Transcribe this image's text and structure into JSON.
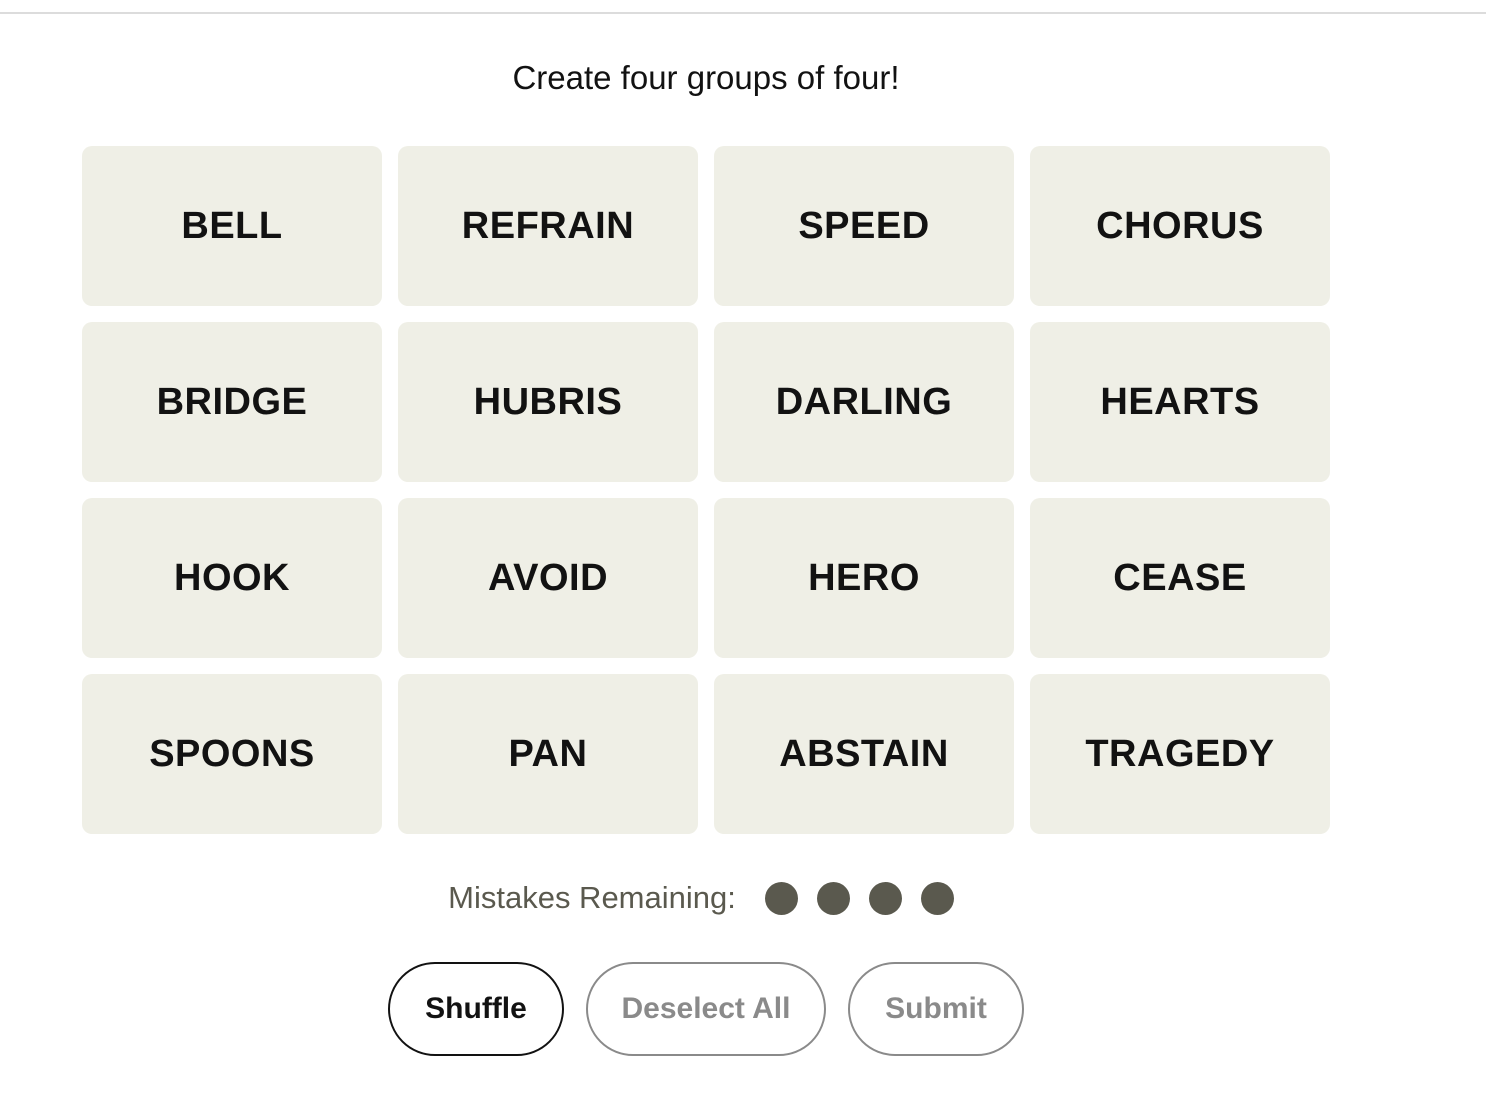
{
  "instructions": "Create four groups of four!",
  "tiles": [
    "BELL",
    "REFRAIN",
    "SPEED",
    "CHORUS",
    "BRIDGE",
    "HUBRIS",
    "DARLING",
    "HEARTS",
    "HOOK",
    "AVOID",
    "HERO",
    "CEASE",
    "SPOONS",
    "PAN",
    "ABSTAIN",
    "TRAGEDY"
  ],
  "mistakes": {
    "label": "Mistakes Remaining:",
    "remaining": 4
  },
  "controls": {
    "shuffle_label": "Shuffle",
    "deselect_label": "Deselect All",
    "submit_label": "Submit"
  },
  "colors": {
    "tile_bg": "#efefe6",
    "text": "#121212",
    "dot": "#5a594e",
    "disabled": "#8a8a8a"
  }
}
